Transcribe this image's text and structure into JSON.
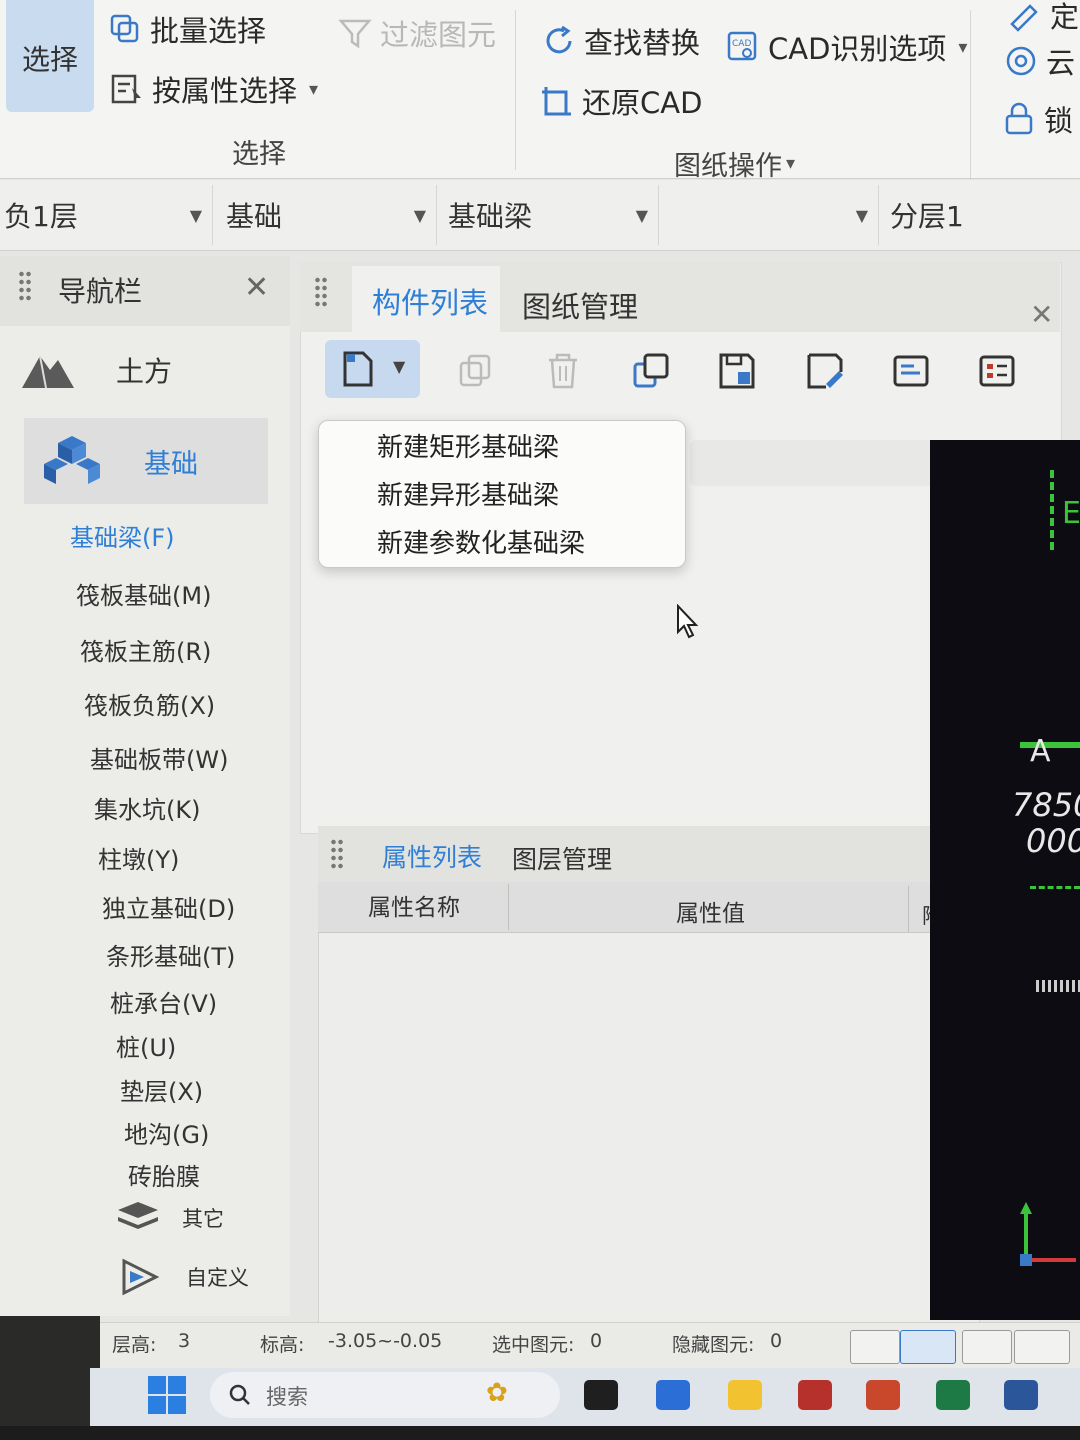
{
  "ribbon": {
    "select_label": "选择",
    "batch_select": "批量选择",
    "filter_elements": "过滤图元",
    "select_by_attr": "按属性选择",
    "select_group": "选择",
    "find_replace": "查找替换",
    "cad_options": "CAD识别选项",
    "restore_cad": "还原CAD",
    "drawing_ops": "图纸操作",
    "cloud_partial": "云",
    "lock_partial": "锁",
    "top_right_partial": "定"
  },
  "layerbar": {
    "floor": "负1层",
    "category": "基础",
    "type": "基础梁",
    "blank": "",
    "sublayer": "分层1"
  },
  "nav": {
    "title": "导航栏",
    "groups": [
      {
        "label": "土方",
        "icon": "earthwork-icon"
      },
      {
        "label": "基础",
        "icon": "foundation-icon"
      }
    ],
    "items": [
      "基础梁(F)",
      "筏板基础(M)",
      "筏板主筋(R)",
      "筏板负筋(X)",
      "基础板带(W)",
      "集水坑(K)",
      "柱墩(Y)",
      "独立基础(D)",
      "条形基础(T)",
      "桩承台(V)",
      "桩(U)",
      "垫层(X)",
      "地沟(G)",
      "砖胎膜"
    ],
    "other": "其它",
    "custom": "自定义"
  },
  "components": {
    "tab_list": "构件列表",
    "tab_drawings": "图纸管理"
  },
  "menu": {
    "items": [
      "新建矩形基础梁",
      "新建异形基础梁",
      "新建参数化基础梁"
    ]
  },
  "properties": {
    "tab_attrs": "属性列表",
    "tab_layers": "图层管理",
    "col_name": "属性名称",
    "col_value": "属性值",
    "col_extra": "附加"
  },
  "cad": {
    "axis_a": "A",
    "num1": "7850",
    "num2": "000",
    "partial_label": "E"
  },
  "status": {
    "floor_height_label": "层高:",
    "floor_height": "3",
    "elevation_label": "标高:",
    "elevation": "-3.05~-0.05",
    "selected_label": "选中图元:",
    "selected": "0",
    "hidden_label": "隐藏图元:",
    "hidden": "0"
  },
  "taskbar": {
    "search_placeholder": "搜索"
  },
  "colors": {
    "accent": "#2f7fd6",
    "active_bg": "#c6d9ef"
  }
}
